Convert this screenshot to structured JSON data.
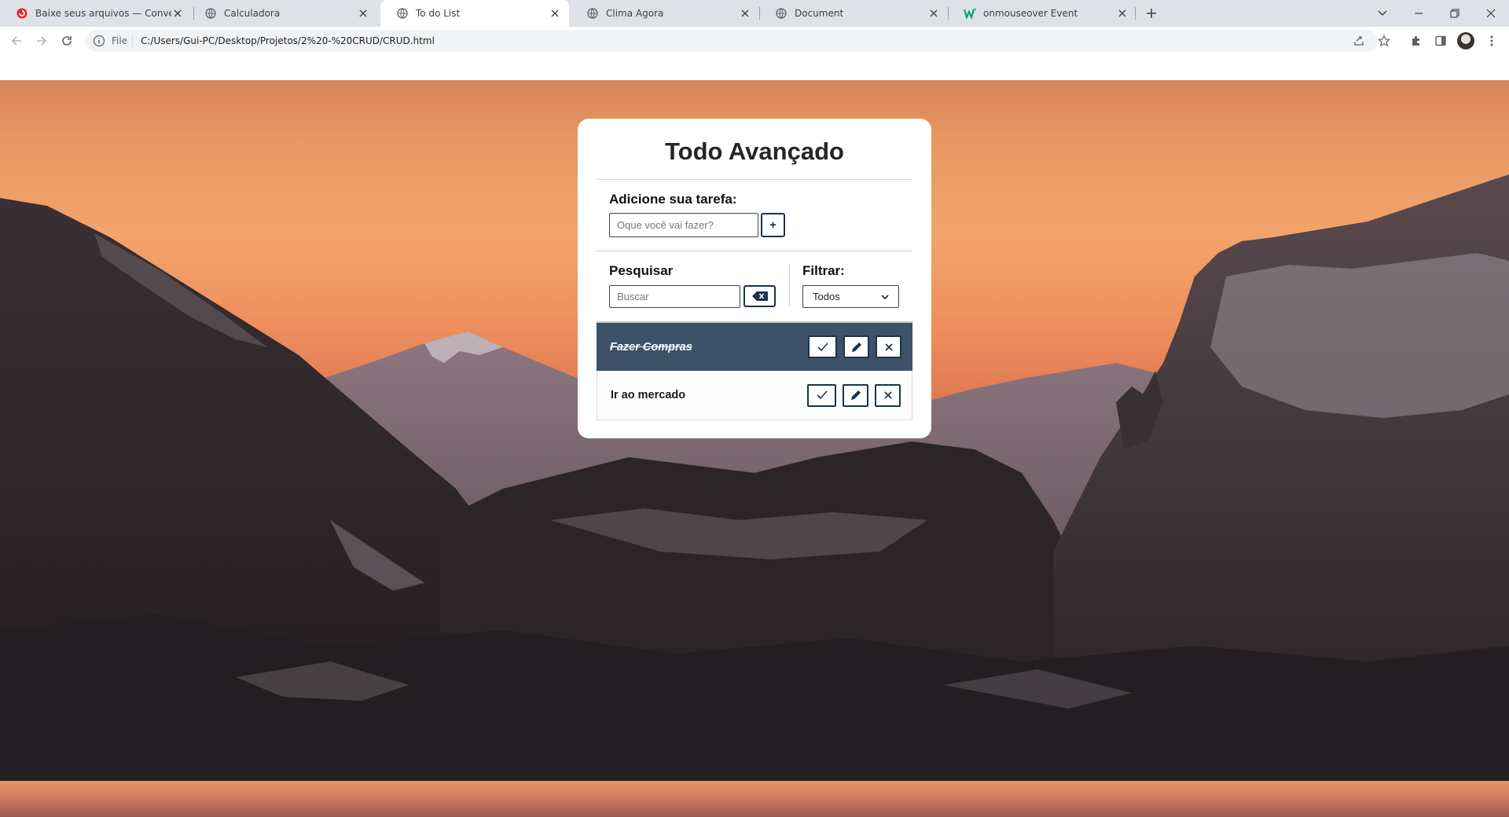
{
  "browser": {
    "tabs": [
      {
        "title": "Baixe seus arquivos — Convertio",
        "icon": "convertio-icon",
        "active": false
      },
      {
        "title": "Calculadora",
        "icon": "globe-icon",
        "active": false
      },
      {
        "title": "To do List",
        "icon": "globe-icon",
        "active": true
      },
      {
        "title": "Clima Agora",
        "icon": "globe-icon",
        "active": false
      },
      {
        "title": "Document",
        "icon": "globe-icon",
        "active": false
      },
      {
        "title": "onmouseover Event",
        "icon": "w3schools-icon",
        "active": false
      }
    ],
    "address": {
      "scheme_label": "File",
      "url": "C:/Users/Gui-PC/Desktop/Projetos/2%20-%20CRUD/CRUD.html"
    }
  },
  "app": {
    "title": "Todo Avançado",
    "add_section": {
      "label": "Adicione sua tarefa:",
      "placeholder": "Oque você vai fazer?",
      "add_button": "+"
    },
    "search_section": {
      "label": "Pesquisar",
      "placeholder": "Buscar"
    },
    "filter_section": {
      "label": "Filtrar:",
      "selected": "Todos"
    },
    "todos": [
      {
        "text": "Fazer Compras",
        "done": true
      },
      {
        "text": "Ir ao mercado",
        "done": false
      }
    ]
  },
  "colors": {
    "accent": "#19344f",
    "done_row": "#3d5168",
    "card": "#ffffff"
  }
}
